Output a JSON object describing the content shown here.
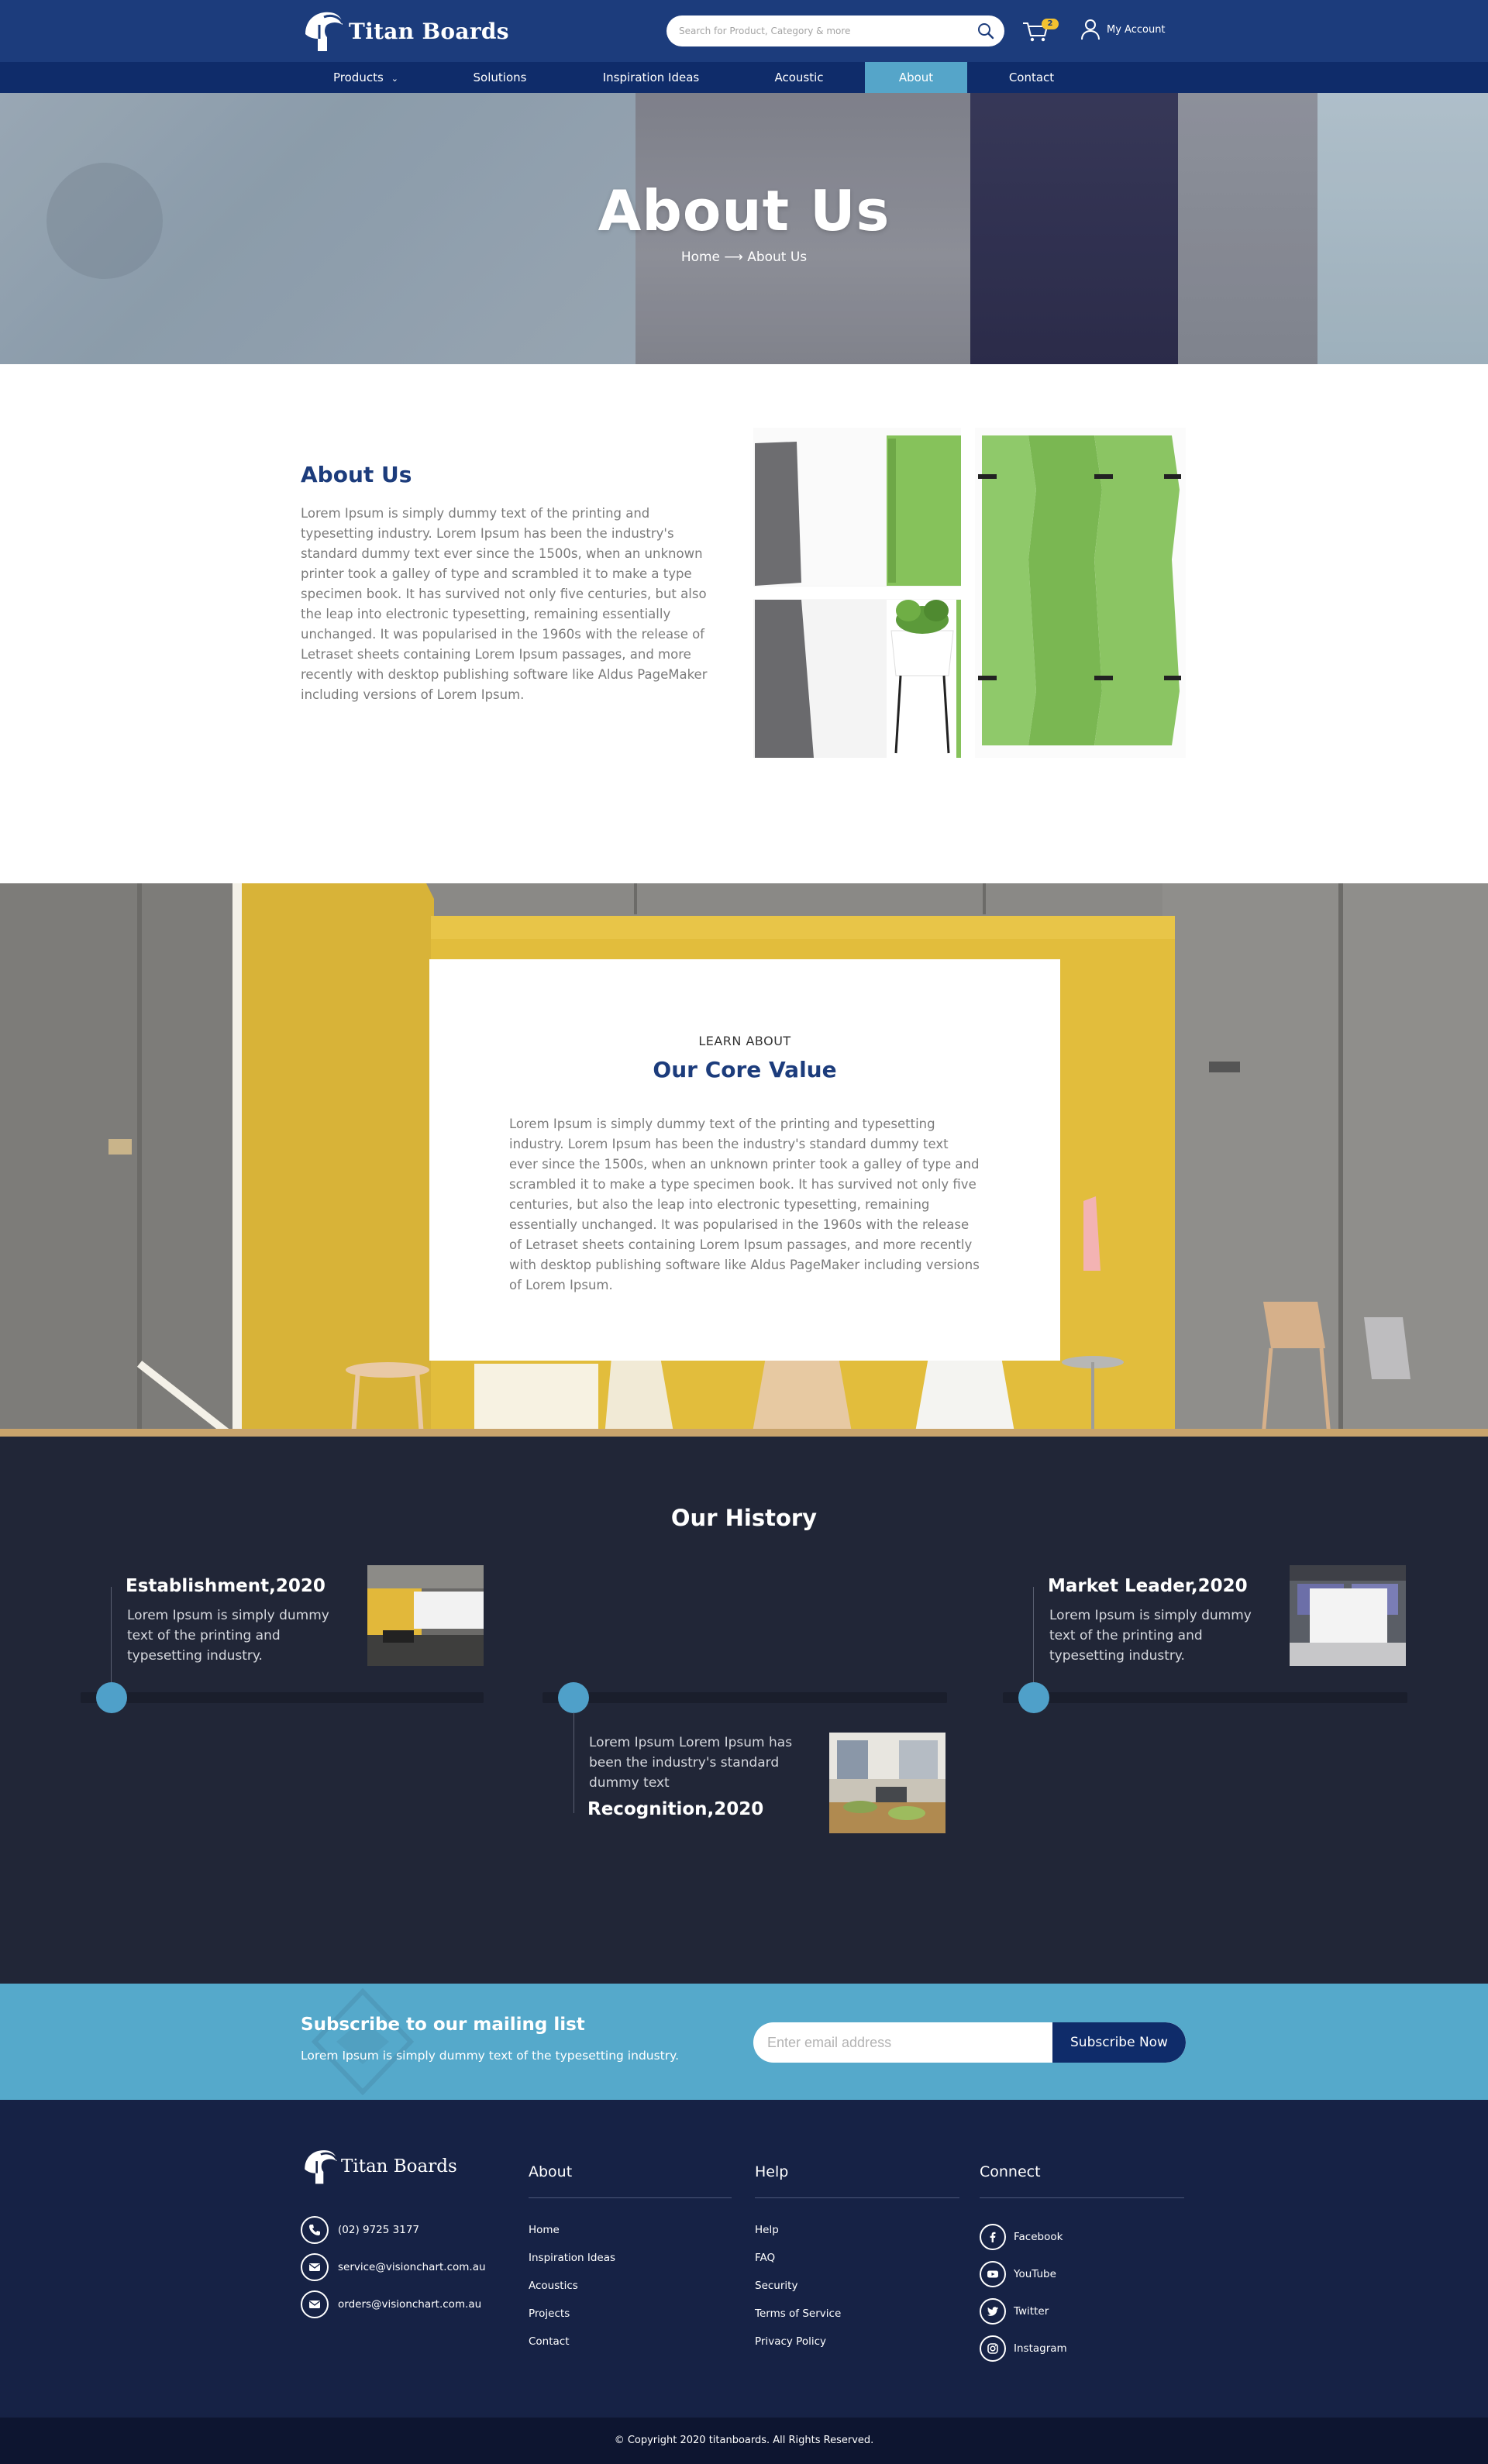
{
  "header": {
    "brand": "Titan Boards",
    "search_placeholder": "Search for Product, Category & more",
    "cart_count": "2",
    "account_label": "My Account"
  },
  "nav": {
    "items": [
      {
        "label": "Products"
      },
      {
        "label": "Solutions"
      },
      {
        "label": "Inspiration Ideas"
      },
      {
        "label": "Acoustic"
      },
      {
        "label": "About"
      },
      {
        "label": "Contact"
      }
    ],
    "active": "About"
  },
  "hero": {
    "title": "About Us",
    "breadcrumb": "Home ⟶ About Us"
  },
  "about": {
    "title": "About Us",
    "text": "Lorem Ipsum is simply dummy text of the printing and typesetting industry. Lorem Ipsum has been the industry's standard dummy text ever since the 1500s, when an unknown printer took a galley of type and scrambled it to make a type specimen book. It has survived not only five centuries, but also the leap into electronic typesetting, remaining essentially unchanged. It was popularised in the 1960s with the release of Letraset sheets containing Lorem Ipsum passages, and more recently with desktop publishing software like Aldus PageMaker including versions of Lorem Ipsum."
  },
  "core": {
    "eyebrow": "LEARN ABOUT",
    "title": "Our Core Value",
    "text": "Lorem Ipsum is simply dummy text of the printing and typesetting industry. Lorem Ipsum has been the industry's standard dummy text ever since the 1500s, when an unknown printer took a galley of type and scrambled it to make a type specimen book. It has survived not only five centuries, but also the leap into electronic typesetting, remaining essentially unchanged. It was popularised in the 1960s with the release of Letraset sheets containing Lorem Ipsum passages, and more recently with desktop publishing software like Aldus PageMaker including versions of Lorem Ipsum."
  },
  "history": {
    "title": "Our History",
    "events": [
      {
        "title": "Establishment,2020",
        "text": "Lorem Ipsum is simply dummy text of the printing and typesetting industry."
      },
      {
        "title": "Recognition,2020",
        "text": "Lorem Ipsum Lorem Ipsum has been the industry's standard dummy text"
      },
      {
        "title": "Market Leader,2020",
        "text": "Lorem Ipsum is simply dummy text of the printing and typesetting industry."
      }
    ]
  },
  "subscribe": {
    "title": "Subscribe to our mailing list",
    "text": "Lorem Ipsum is simply dummy text of the typesetting industry.",
    "placeholder": "Enter email address",
    "button": "Subscribe Now"
  },
  "footer": {
    "brand": "Titan Boards",
    "contacts": [
      {
        "icon": "phone-icon",
        "text": "(02) 9725 3177"
      },
      {
        "icon": "mail-icon",
        "text": "service@visionchart.com.au"
      },
      {
        "icon": "mail-icon",
        "text": "orders@visionchart.com.au"
      }
    ],
    "columns": [
      {
        "title": "About",
        "links": [
          "Home",
          "Inspiration Ideas",
          "Acoustics",
          "Projects",
          "Contact"
        ]
      },
      {
        "title": "Help",
        "links": [
          "Help",
          "FAQ",
          "Security",
          "Terms of Service",
          "Privacy Policy"
        ]
      },
      {
        "title": "Connect",
        "links": [
          "Facebook",
          "YouTube",
          "Twitter",
          "Instagram"
        ]
      }
    ],
    "copyright": "© Copyright 2020 titanboards. All Rights Reserved."
  },
  "colors": {
    "primary": "#1c3c7c",
    "nav_dark": "#0f2c6a",
    "accent": "#55a5c9",
    "history_bg": "#212637",
    "footer_bg": "#162245",
    "badge": "#f2c230"
  }
}
